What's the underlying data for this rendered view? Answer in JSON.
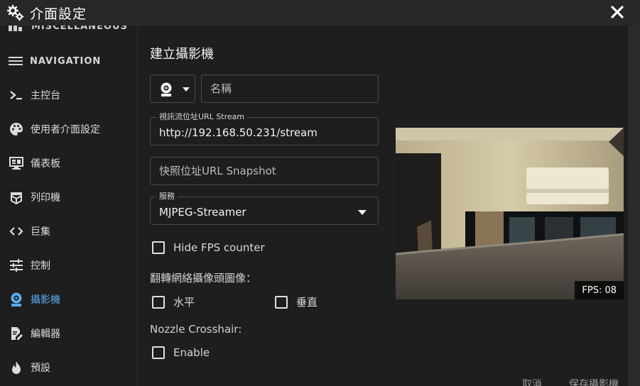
{
  "window": {
    "title": "介面設定",
    "title_icon": "gears-icon",
    "close_icon": "close-icon"
  },
  "sidebar": {
    "cut_item": {
      "label": "MISCELLANEOUS",
      "icon": "grid-icon"
    },
    "nav_header": {
      "label": "NAVIGATION",
      "icon": "menu-icon"
    },
    "items": [
      {
        "label": "主控台",
        "icon": "console-icon",
        "active": false
      },
      {
        "label": "使用者介面設定",
        "icon": "palette-icon",
        "active": false
      },
      {
        "label": "儀表板",
        "icon": "dashboard-icon",
        "active": false
      },
      {
        "label": "列印機",
        "icon": "printer-3d-icon",
        "active": false
      },
      {
        "label": "巨集",
        "icon": "code-icon",
        "active": false
      },
      {
        "label": "控制",
        "icon": "sliders-icon",
        "active": false
      },
      {
        "label": "攝影機",
        "icon": "webcam-icon",
        "active": true
      },
      {
        "label": "編輯器",
        "icon": "file-edit-icon",
        "active": false
      },
      {
        "label": "預設",
        "icon": "fire-icon",
        "active": false
      }
    ]
  },
  "form": {
    "title": "建立攝影機",
    "icon_select": {
      "icon": "webcam-icon"
    },
    "name": {
      "placeholder": "名稱",
      "value": ""
    },
    "stream_url": {
      "label": "視訊流位址URL Stream",
      "value": "http://192.168.50.231/stream"
    },
    "snapshot_url": {
      "placeholder": "快照位址URL Snapshot",
      "value": ""
    },
    "service": {
      "label": "服務",
      "value": "MJPEG-Streamer"
    },
    "hide_fps": {
      "label": "Hide FPS counter",
      "checked": false
    },
    "flip_label": "翻轉網絡攝像頭圖像：",
    "flip_horizontal": {
      "label": "水平",
      "checked": false
    },
    "flip_vertical": {
      "label": "垂直",
      "checked": false
    },
    "nozzle_label": "Nozzle Crosshair:",
    "nozzle_enable": {
      "label": "Enable",
      "checked": false
    }
  },
  "preview": {
    "fps_text": "FPS: 08"
  },
  "footer": {
    "cancel_label": "取消",
    "save_label": "保存攝影機"
  },
  "colors": {
    "background": "#1e1e1e",
    "titlebar": "#282828",
    "accent": "#5aa9ef",
    "border": "#4a4a4a"
  }
}
